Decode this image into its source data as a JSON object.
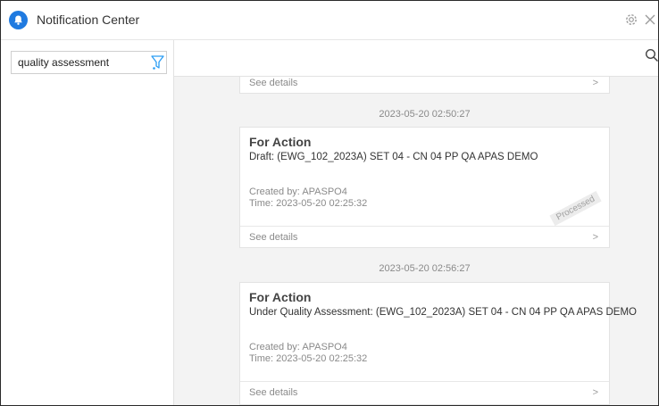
{
  "window": {
    "title": "Notification Center"
  },
  "sidebar": {
    "search": {
      "value": "quality assessment"
    }
  },
  "icons": {
    "app": "notification-bell-icon",
    "settings": "gear-icon",
    "close": "close-icon",
    "filter": "filter-icon",
    "search": "search-icon",
    "chevron": "chevron-right-icon"
  },
  "colors": {
    "accent": "#1f7ae0",
    "feed_bg": "#f3f3f3",
    "filter_icon": "#2a9df4"
  },
  "feed": {
    "partial_card": {
      "details_label": "See details",
      "chevron": ">"
    },
    "items": [
      {
        "timestamp": "2023-05-20 02:50:27",
        "type": "For Action",
        "description": "Draft: (EWG_102_2023A) SET 04 - CN 04 PP QA APAS DEMO",
        "created_by": "Created by:  APASPO4",
        "time": "Time: 2023-05-20 02:25:32",
        "status": "Processed",
        "details_label": "See details",
        "chevron": ">"
      },
      {
        "timestamp": "2023-05-20 02:56:27",
        "type": "For Action",
        "description": "Under Quality Assessment: (EWG_102_2023A) SET 04 - CN 04 PP QA APAS DEMO",
        "created_by": "Created by:  APASPO4",
        "time": "Time: 2023-05-20 02:25:32",
        "details_label": "See details",
        "chevron": ">"
      }
    ]
  }
}
